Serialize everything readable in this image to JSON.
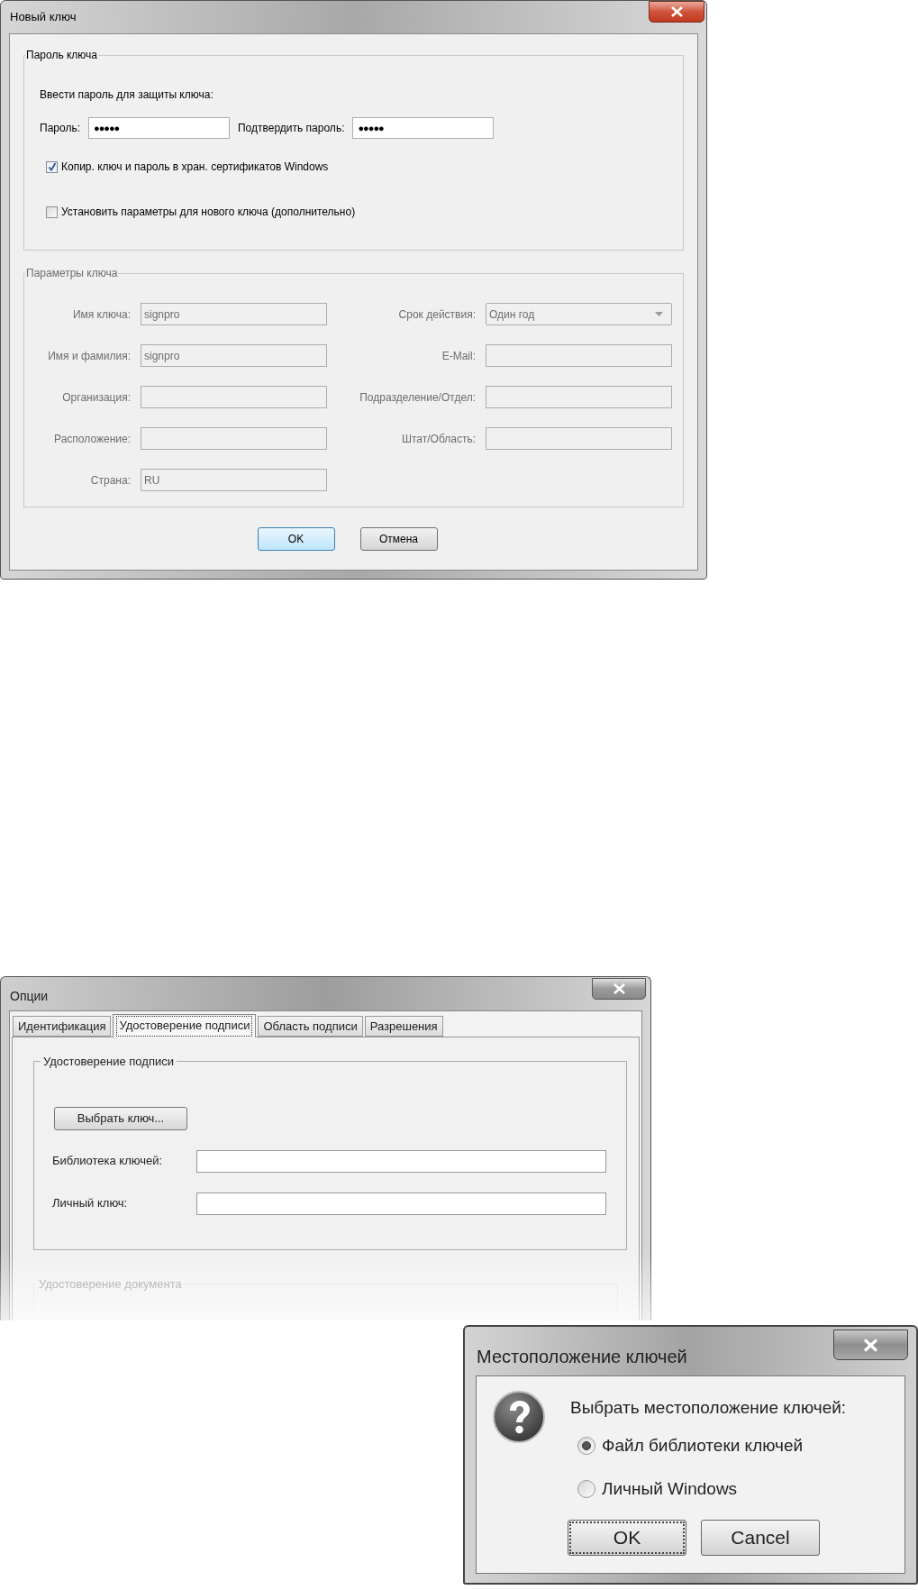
{
  "key_dialog": {
    "title": "Новый ключ",
    "password_group": {
      "legend": "Пароль ключа",
      "prompt": "Ввести пароль для защиты ключа:",
      "password": {
        "label": "Пароль:",
        "value": "●●●●●"
      },
      "confirm": {
        "label": "Подтвердить пароль:",
        "value": "●●●●●"
      },
      "checkboxes": [
        {
          "label": "Копир. ключ и пароль в хран. сертификатов Windows",
          "checked": true
        },
        {
          "label": "Установить параметры для нового ключа (дополнительно)",
          "checked": false
        }
      ]
    },
    "params_group": {
      "legend": "Параметры ключа",
      "disabled": true,
      "fields": [
        {
          "kind": "text",
          "label": "Имя ключа:",
          "value": "signpro"
        },
        {
          "kind": "dropdown",
          "label": "Срок действия:",
          "value": "Один год"
        },
        {
          "kind": "text",
          "label": "Имя и фамилия:",
          "value": "signpro"
        },
        {
          "kind": "text",
          "label": "E-Mail:"
        },
        {
          "kind": "text",
          "label": "Организация:"
        },
        {
          "kind": "text",
          "label": "Подразделение/Отдел:"
        },
        {
          "kind": "text",
          "label": "Расположение:"
        },
        {
          "kind": "text",
          "label": "Штат/Область:"
        },
        {
          "kind": "text",
          "label": "Страна:",
          "value": "RU"
        }
      ]
    },
    "buttons": [
      {
        "label": "OK",
        "default": true
      },
      {
        "label": "Отмена",
        "default": false
      }
    ]
  },
  "options_dialog": {
    "title": "Опции",
    "tabs": [
      {
        "label": "Идентификация",
        "selected": false
      },
      {
        "label": "Удостоверение подписи",
        "selected": true
      },
      {
        "label": "Область подписи",
        "selected": false
      },
      {
        "label": "Разрешения",
        "selected": false
      }
    ],
    "group": {
      "legend": "Удостоверение подписи",
      "button": "Выбрать ключ...",
      "fields": [
        {
          "label": "Библиотека ключей:"
        },
        {
          "label": "Личный ключ:"
        }
      ]
    },
    "faded_group": {
      "legend": "Удостоверение документа"
    }
  },
  "location_dialog": {
    "title": "Местоположение ключей",
    "prompt": "Выбрать местоположение ключей:",
    "options": [
      {
        "label": "Файл библиотеки ключей",
        "selected": true
      },
      {
        "label": "Личный Windows",
        "selected": false
      }
    ],
    "buttons": [
      {
        "label": "OK",
        "focused": true
      },
      {
        "label": "Cancel",
        "focused": false
      }
    ]
  }
}
